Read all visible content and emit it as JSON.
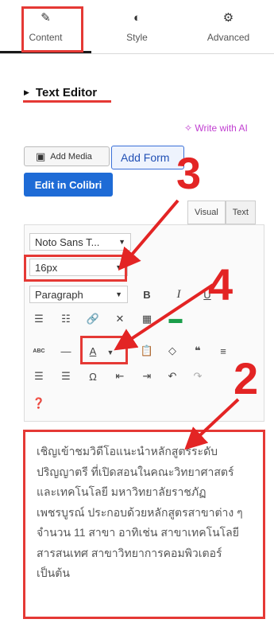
{
  "tabs": [
    {
      "label": "Content",
      "icon": "pencil-icon"
    },
    {
      "label": "Style",
      "icon": "half-circle-icon"
    },
    {
      "label": "Advanced",
      "icon": "gear-icon"
    }
  ],
  "section": {
    "title": "Text Editor"
  },
  "ai_link": "Write with AI",
  "buttons": {
    "add_media": "Add Media",
    "add_form": "Add Form",
    "edit_colibri": "Edit in Colibri"
  },
  "editor_tabs": {
    "visual": "Visual",
    "text": "Text"
  },
  "toolbar": {
    "font_family": "Noto Sans T...",
    "font_size": "16px",
    "format": "Paragraph",
    "bold": "B",
    "italic": "I",
    "underline": "U",
    "text_color": "A",
    "abc": "ABC"
  },
  "content_text": "เชิญเข้าชมวิดีโอแนะนำหลักสูตรระดับปริญญาตรี ที่เปิดสอนในคณะวิทยาศาสตร์และเทคโนโลยี มหาวิทยาลัยราชภัฏเพชรบูรณ์ ประกอบด้วยหลักสูตรสาขาต่าง ๆ จำนวน 11 สาขา อาทิเช่น สาขาเทคโนโลยีสารสนเทศ สาขาวิทยาการคอมพิวเตอร์ เป็นต้น",
  "annotations": [
    "3",
    "4",
    "2"
  ],
  "colors": {
    "accent_red": "#e53935",
    "primary_blue": "#1e6bd6",
    "ai_purple": "#c13fd1",
    "green_icon": "#1a9e4a"
  }
}
